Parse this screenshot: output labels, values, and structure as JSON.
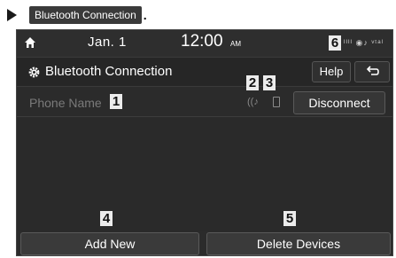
{
  "doc": {
    "heading_label": "Bluetooth Connection",
    "period": "."
  },
  "status_bar": {
    "date": "Jan.  1",
    "time": "12:00",
    "ampm": "AM",
    "indicators": "ᴵᴵᴵᴵ ◉♪ ᵛᵗᵃˡ"
  },
  "title_bar": {
    "title": "Bluetooth Connection",
    "help_label": "Help",
    "back_icon": "back-arrow-icon"
  },
  "device_row": {
    "phone_name": "Phone Name",
    "disconnect_label": "Disconnect",
    "audio_icon": "audio-streaming-icon",
    "phone_icon": "handsfree-phone-icon"
  },
  "buttons": {
    "add_new": "Add New",
    "delete_devices": "Delete Devices"
  },
  "callouts": [
    "1",
    "2",
    "3",
    "4",
    "5",
    "6"
  ],
  "colors": {
    "screen_bg": "#2b2b2b",
    "text": "#ffffff",
    "muted_text": "#7a7a7a",
    "callout_bg": "#ececec"
  }
}
